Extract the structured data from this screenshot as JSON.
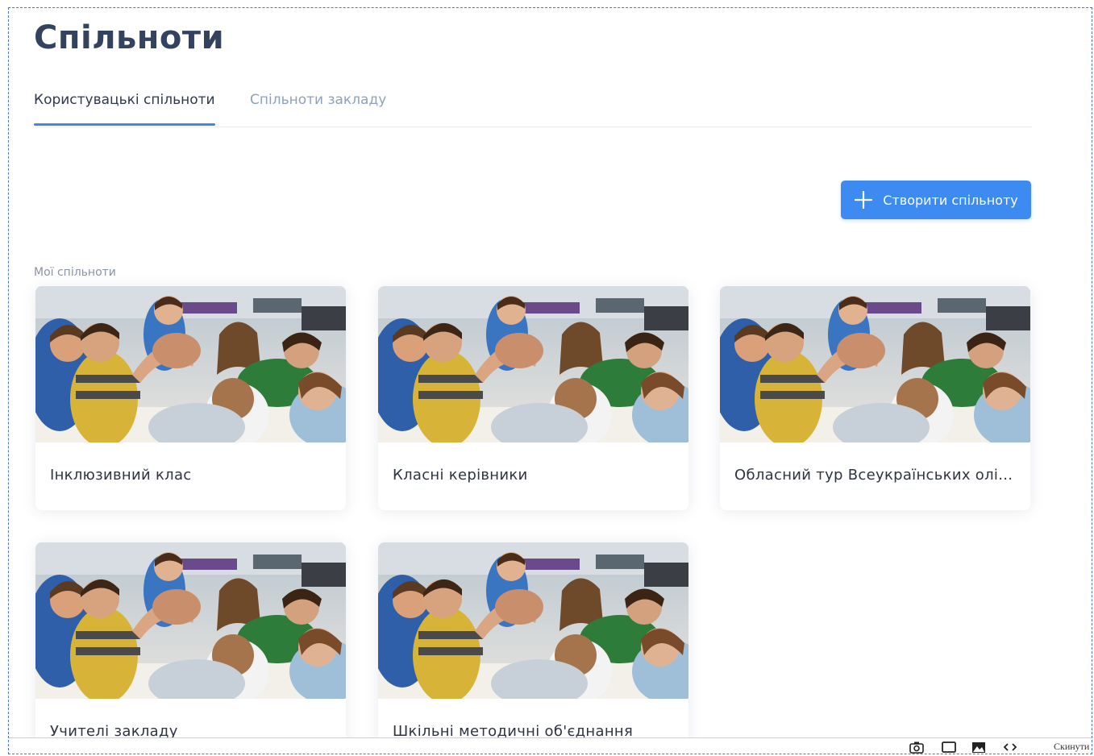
{
  "page": {
    "title": "Спільноти"
  },
  "tabs": [
    {
      "label": "Користувацькі спільноти",
      "active": true
    },
    {
      "label": "Спільноти закладу",
      "active": false
    }
  ],
  "toolbar": {
    "create_label": "Створити спільноту",
    "create_icon": "plus-icon"
  },
  "section": {
    "label": "Мої спільноти"
  },
  "communities": [
    {
      "title": "Інклюзивний клас"
    },
    {
      "title": "Класні керівники"
    },
    {
      "title": "Обласний тур Всеукраїнських олі..."
    },
    {
      "title": "Учителі закладу"
    },
    {
      "title": "Шкільні методичні об'єднання"
    }
  ],
  "bottom_bar": {
    "reset_label": "Скинути",
    "icons": [
      "camera-icon",
      "window-icon",
      "image-icon",
      "code-icon"
    ]
  },
  "colors": {
    "accent": "#3d8bf0",
    "title": "#33435f",
    "tab_inactive": "#8fa2bd",
    "frame_border": "#4a74c9"
  }
}
